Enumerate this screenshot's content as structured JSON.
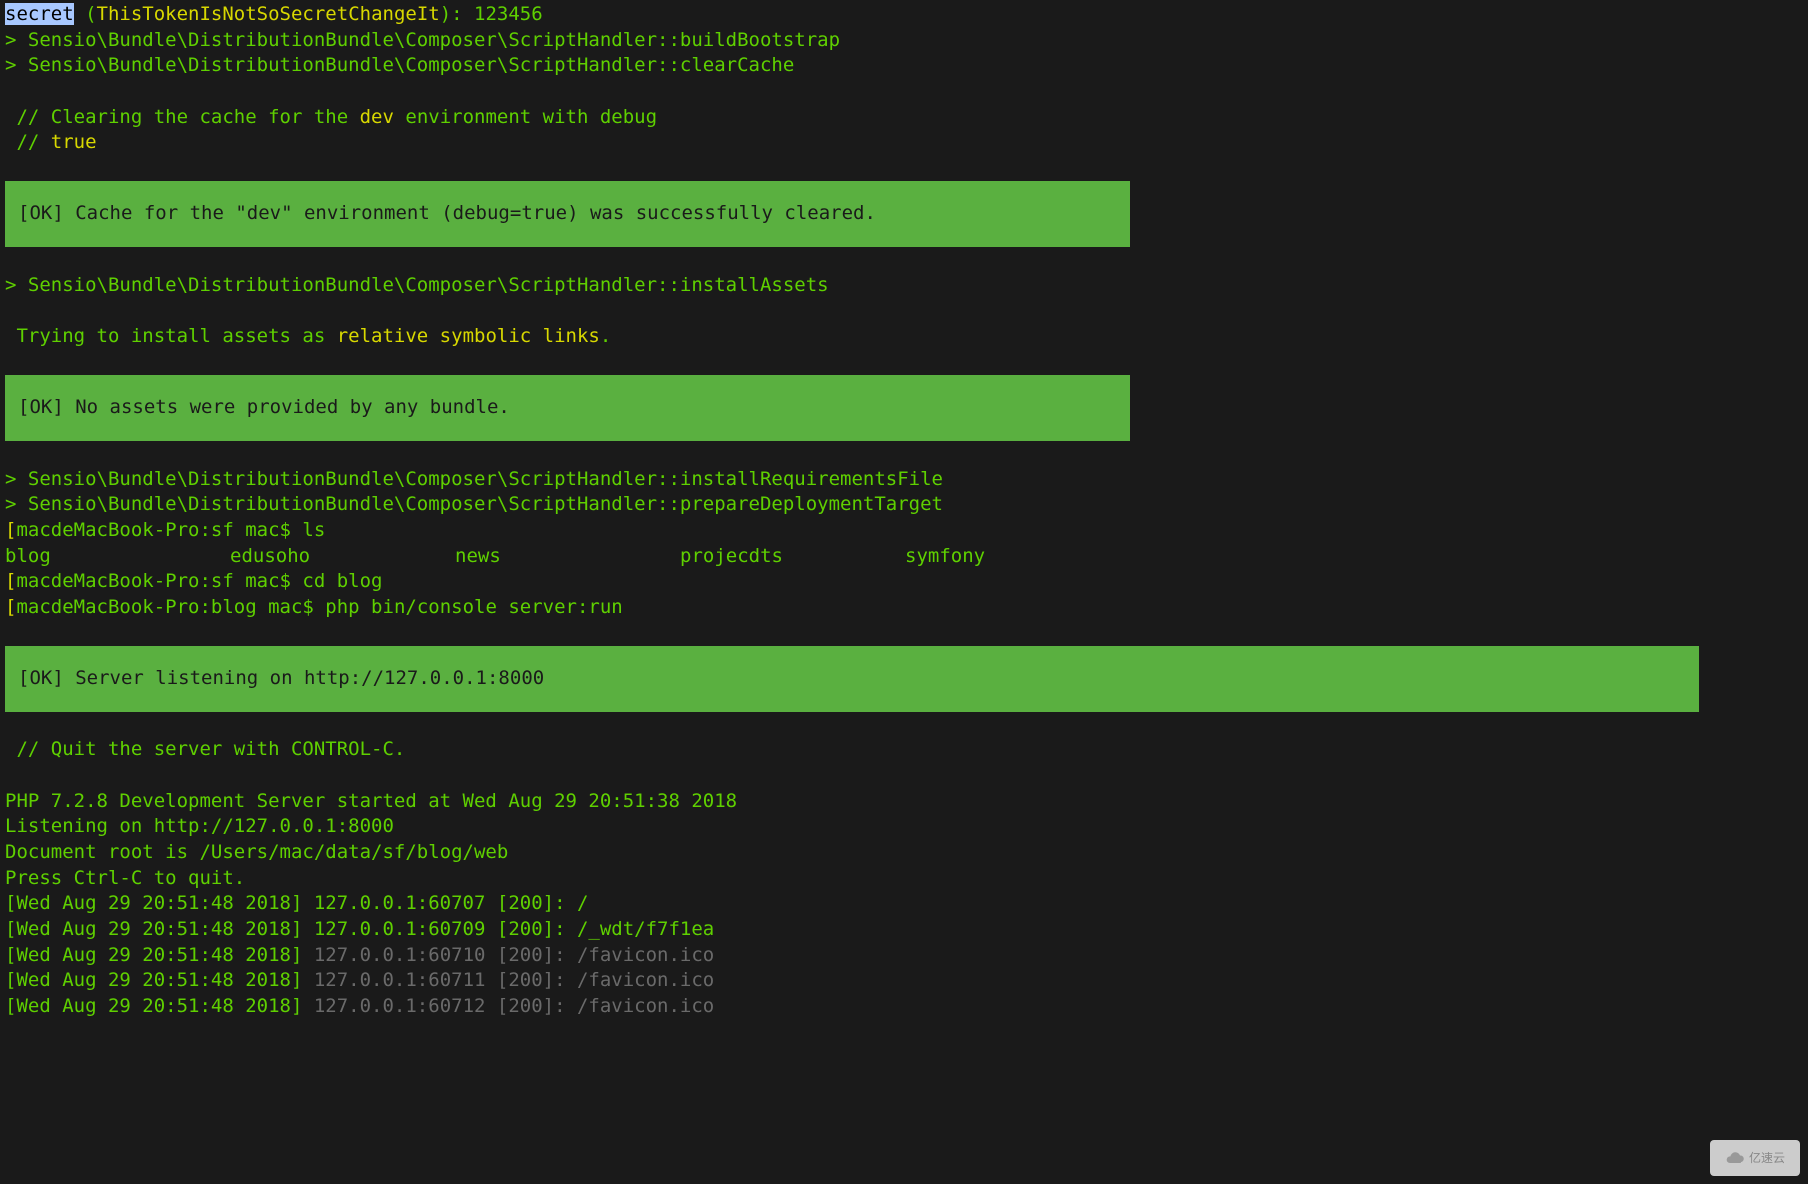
{
  "header": {
    "secret_label": "secret",
    "secret_paren_open": " (",
    "secret_token": "ThisTokenIsNotSoSecretChangeIt",
    "secret_paren_close": "): ",
    "secret_value": "123456"
  },
  "lines": {
    "build_bootstrap": "> Sensio\\Bundle\\DistributionBundle\\Composer\\ScriptHandler::buildBootstrap",
    "clear_cache": "> Sensio\\Bundle\\DistributionBundle\\Composer\\ScriptHandler::clearCache",
    "comment_clear_1a": " // Clearing the cache for the ",
    "comment_clear_dev": "dev",
    "comment_clear_1b": " environment with debug",
    "comment_clear_2a": " // ",
    "comment_clear_true": "true",
    "ok_cache": " [OK] Cache for the \"dev\" environment (debug=true) was successfully cleared.",
    "install_assets": "> Sensio\\Bundle\\DistributionBundle\\Composer\\ScriptHandler::installAssets",
    "trying_assets_a": " Trying to install assets as ",
    "trying_assets_b": "relative symbolic links",
    "trying_assets_c": ".",
    "ok_assets": " [OK] No assets were provided by any bundle.",
    "install_req": "> Sensio\\Bundle\\DistributionBundle\\Composer\\ScriptHandler::installRequirementsFile",
    "prepare_deploy": "> Sensio\\Bundle\\DistributionBundle\\Composer\\ScriptHandler::prepareDeploymentTarget",
    "prompt_ls_a": "[",
    "prompt_ls_b": "macdeMacBook-Pro:sf mac$ ls",
    "prompt_cd_a": "[",
    "prompt_cd_b": "macdeMacBook-Pro:sf mac$ cd blog",
    "prompt_run_a": "[",
    "prompt_run_b": "macdeMacBook-Pro:blog mac$ php bin/console server:run",
    "ok_server": " [OK] Server listening on http://127.0.0.1:8000",
    "quit_comment": " // Quit the server with CONTROL-C.",
    "php_started": "PHP 7.2.8 Development Server started at Wed Aug 29 20:51:38 2018",
    "listening": "Listening on http://127.0.0.1:8000",
    "docroot": "Document root is /Users/mac/data/sf/blog/web",
    "press_ctrlc": "Press Ctrl-C to quit.",
    "req1": "[Wed Aug 29 20:51:48 2018] 127.0.0.1:60707 [200]: /",
    "req2": "[Wed Aug 29 20:51:48 2018] 127.0.0.1:60709 [200]: /_wdt/f7f1ea",
    "req3_a": "[Wed Aug 29 20:51:48 2018] ",
    "req3_b": "127.0.0.1:60710 [200]: /favicon.ico",
    "req4_a": "[Wed Aug 29 20:51:48 2018] ",
    "req4_b": "127.0.0.1:60711 [200]: /favicon.ico",
    "req5_a": "[Wed Aug 29 20:51:48 2018] ",
    "req5_b": "127.0.0.1:60712 [200]: /favicon.ico"
  },
  "ls": {
    "items": [
      "blog",
      "edusoho",
      "news",
      "projecdts",
      "symfony"
    ]
  },
  "watermark": "亿速云"
}
